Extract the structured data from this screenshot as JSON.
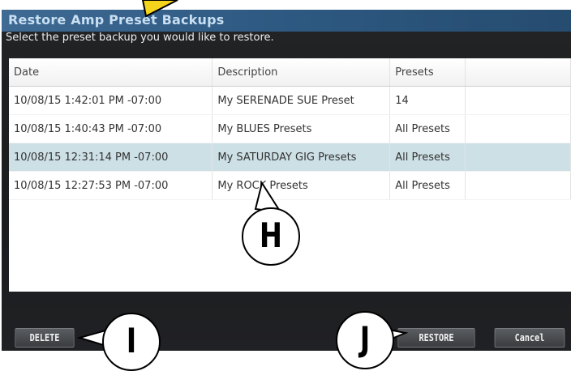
{
  "dialog": {
    "title": "Restore Amp Preset Backups",
    "prompt": "Select the preset backup you would like to restore."
  },
  "table": {
    "columns": [
      "Date",
      "Description",
      "Presets"
    ],
    "rows": [
      {
        "date": "10/08/15 1:42:01 PM -07:00",
        "description": "My SERENADE SUE Preset",
        "presets": "14"
      },
      {
        "date": "10/08/15 1:40:43 PM -07:00",
        "description": "My BLUES Presets",
        "presets": "All Presets"
      },
      {
        "date": "10/08/15 12:31:14 PM -07:00",
        "description": "My SATURDAY GIG Presets",
        "presets": "All Presets"
      },
      {
        "date": "10/08/15 12:27:53 PM -07:00",
        "description": "My ROCK Presets",
        "presets": "All Presets"
      }
    ]
  },
  "buttons": {
    "delete": "DELETE",
    "restore": "RESTORE",
    "cancel": "Cancel"
  },
  "callouts": {
    "h": "H",
    "i": "I",
    "j": "J"
  },
  "colors": {
    "titlebar": "#2e5a83",
    "selected_row": "#cde0e6",
    "arrow_yellow": "#f5d41c"
  }
}
